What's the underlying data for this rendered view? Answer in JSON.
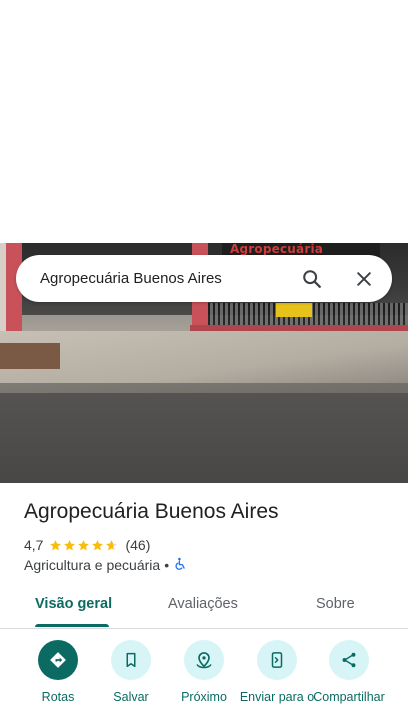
{
  "search": {
    "query": "Agropecuária Buenos Aires"
  },
  "photo": {
    "sign_text": "Agropecuária"
  },
  "place": {
    "name": "Agropecuária Buenos Aires",
    "rating": "4,7",
    "rating_value": 4.7,
    "reviews_count": "(46)",
    "category": "Agricultura e pecuária",
    "separator": "•"
  },
  "tabs": [
    {
      "label": "Visão geral",
      "active": true
    },
    {
      "label": "Avaliações",
      "active": false
    },
    {
      "label": "Sobre",
      "active": false
    }
  ],
  "actions": [
    {
      "label": "Rotas",
      "icon": "directions-icon"
    },
    {
      "label": "Salvar",
      "icon": "bookmark-icon"
    },
    {
      "label": "Próximo",
      "icon": "nearby-icon"
    },
    {
      "label": "Enviar para o",
      "icon": "send-to-phone-icon"
    },
    {
      "label": "Compartilhar",
      "icon": "share-icon"
    }
  ],
  "colors": {
    "accent": "#0b6b63",
    "action_bg": "#d7f5f7",
    "star": "#fbbc04",
    "accessibility": "#1a73e8"
  }
}
